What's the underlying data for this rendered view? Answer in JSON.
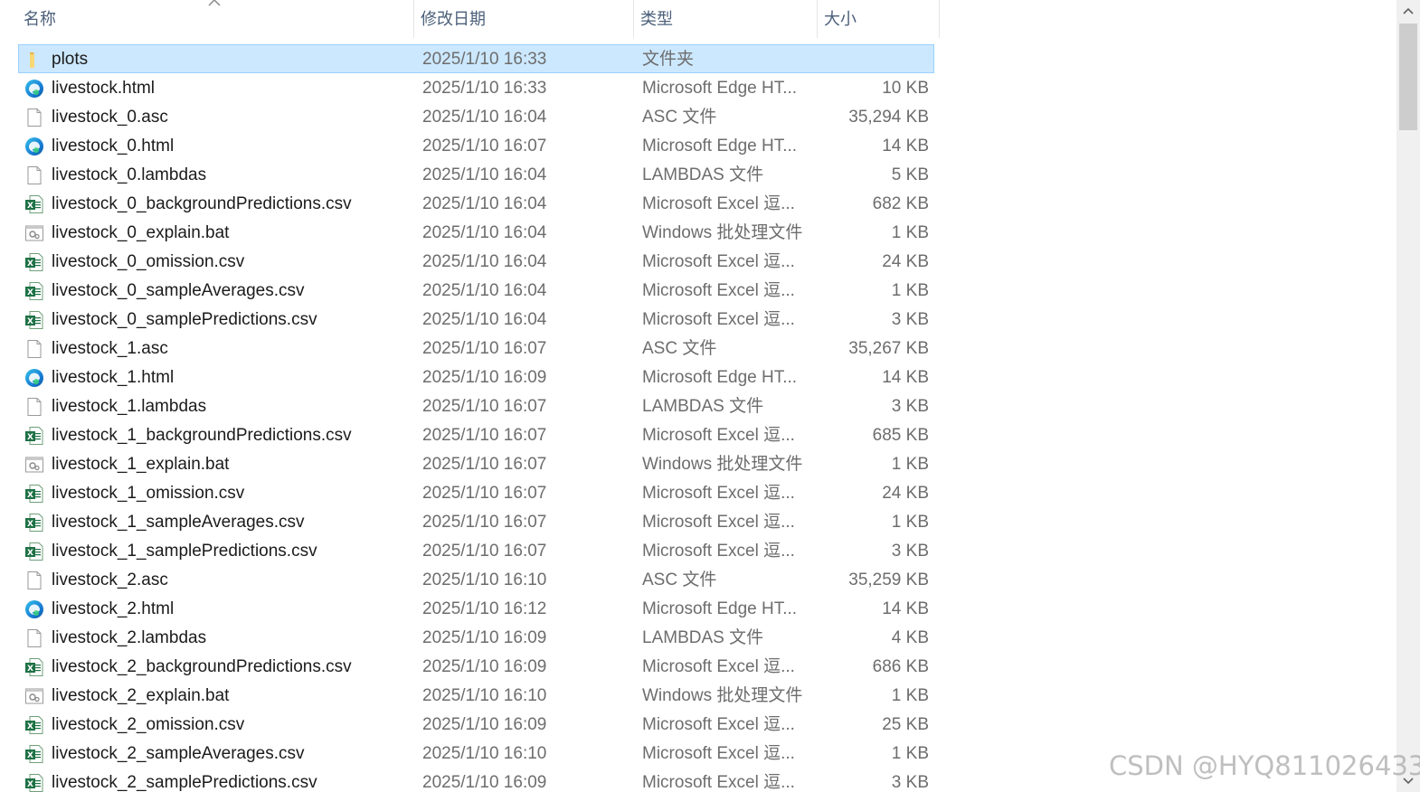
{
  "header": {
    "col_name": "名称",
    "col_date": "修改日期",
    "col_type": "类型",
    "col_size": "大小"
  },
  "files": [
    {
      "name": "plots",
      "date": "2025/1/10 16:33",
      "type": "文件夹",
      "size": "",
      "icon": "folder-icon",
      "selected": true
    },
    {
      "name": "livestock.html",
      "date": "2025/1/10 16:33",
      "type": "Microsoft Edge HT...",
      "size": "10 KB",
      "icon": "edge-icon"
    },
    {
      "name": "livestock_0.asc",
      "date": "2025/1/10 16:04",
      "type": "ASC 文件",
      "size": "35,294 KB",
      "icon": "blank-file-icon"
    },
    {
      "name": "livestock_0.html",
      "date": "2025/1/10 16:07",
      "type": "Microsoft Edge HT...",
      "size": "14 KB",
      "icon": "edge-icon"
    },
    {
      "name": "livestock_0.lambdas",
      "date": "2025/1/10 16:04",
      "type": "LAMBDAS 文件",
      "size": "5 KB",
      "icon": "blank-file-icon"
    },
    {
      "name": "livestock_0_backgroundPredictions.csv",
      "date": "2025/1/10 16:04",
      "type": "Microsoft Excel 逗...",
      "size": "682 KB",
      "icon": "excel-icon"
    },
    {
      "name": "livestock_0_explain.bat",
      "date": "2025/1/10 16:04",
      "type": "Windows 批处理文件",
      "size": "1 KB",
      "icon": "batch-file-icon"
    },
    {
      "name": "livestock_0_omission.csv",
      "date": "2025/1/10 16:04",
      "type": "Microsoft Excel 逗...",
      "size": "24 KB",
      "icon": "excel-icon"
    },
    {
      "name": "livestock_0_sampleAverages.csv",
      "date": "2025/1/10 16:04",
      "type": "Microsoft Excel 逗...",
      "size": "1 KB",
      "icon": "excel-icon"
    },
    {
      "name": "livestock_0_samplePredictions.csv",
      "date": "2025/1/10 16:04",
      "type": "Microsoft Excel 逗...",
      "size": "3 KB",
      "icon": "excel-icon"
    },
    {
      "name": "livestock_1.asc",
      "date": "2025/1/10 16:07",
      "type": "ASC 文件",
      "size": "35,267 KB",
      "icon": "blank-file-icon"
    },
    {
      "name": "livestock_1.html",
      "date": "2025/1/10 16:09",
      "type": "Microsoft Edge HT...",
      "size": "14 KB",
      "icon": "edge-icon"
    },
    {
      "name": "livestock_1.lambdas",
      "date": "2025/1/10 16:07",
      "type": "LAMBDAS 文件",
      "size": "3 KB",
      "icon": "blank-file-icon"
    },
    {
      "name": "livestock_1_backgroundPredictions.csv",
      "date": "2025/1/10 16:07",
      "type": "Microsoft Excel 逗...",
      "size": "685 KB",
      "icon": "excel-icon"
    },
    {
      "name": "livestock_1_explain.bat",
      "date": "2025/1/10 16:07",
      "type": "Windows 批处理文件",
      "size": "1 KB",
      "icon": "batch-file-icon"
    },
    {
      "name": "livestock_1_omission.csv",
      "date": "2025/1/10 16:07",
      "type": "Microsoft Excel 逗...",
      "size": "24 KB",
      "icon": "excel-icon"
    },
    {
      "name": "livestock_1_sampleAverages.csv",
      "date": "2025/1/10 16:07",
      "type": "Microsoft Excel 逗...",
      "size": "1 KB",
      "icon": "excel-icon"
    },
    {
      "name": "livestock_1_samplePredictions.csv",
      "date": "2025/1/10 16:07",
      "type": "Microsoft Excel 逗...",
      "size": "3 KB",
      "icon": "excel-icon"
    },
    {
      "name": "livestock_2.asc",
      "date": "2025/1/10 16:10",
      "type": "ASC 文件",
      "size": "35,259 KB",
      "icon": "blank-file-icon"
    },
    {
      "name": "livestock_2.html",
      "date": "2025/1/10 16:12",
      "type": "Microsoft Edge HT...",
      "size": "14 KB",
      "icon": "edge-icon"
    },
    {
      "name": "livestock_2.lambdas",
      "date": "2025/1/10 16:09",
      "type": "LAMBDAS 文件",
      "size": "4 KB",
      "icon": "blank-file-icon"
    },
    {
      "name": "livestock_2_backgroundPredictions.csv",
      "date": "2025/1/10 16:09",
      "type": "Microsoft Excel 逗...",
      "size": "686 KB",
      "icon": "excel-icon"
    },
    {
      "name": "livestock_2_explain.bat",
      "date": "2025/1/10 16:10",
      "type": "Windows 批处理文件",
      "size": "1 KB",
      "icon": "batch-file-icon"
    },
    {
      "name": "livestock_2_omission.csv",
      "date": "2025/1/10 16:09",
      "type": "Microsoft Excel 逗...",
      "size": "25 KB",
      "icon": "excel-icon"
    },
    {
      "name": "livestock_2_sampleAverages.csv",
      "date": "2025/1/10 16:10",
      "type": "Microsoft Excel 逗...",
      "size": "1 KB",
      "icon": "excel-icon"
    },
    {
      "name": "livestock_2_samplePredictions.csv",
      "date": "2025/1/10 16:09",
      "type": "Microsoft Excel 逗...",
      "size": "3 KB",
      "icon": "excel-icon"
    }
  ],
  "watermark": "CSDN @HYQ811026433",
  "colors": {
    "selection_bg": "#cce8ff",
    "selection_border": "#99d1ff",
    "header_text": "#4c607a",
    "secondary_text": "#6d6d6d"
  }
}
